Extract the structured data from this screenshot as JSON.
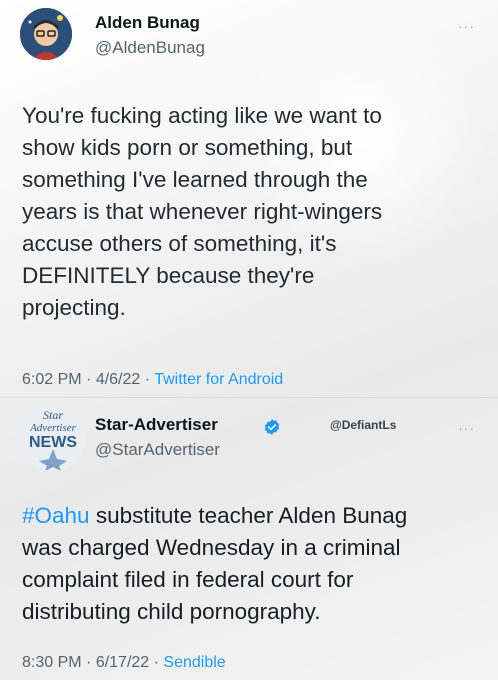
{
  "tweet1": {
    "name": "Alden Bunag",
    "handle": "@AldenBunag",
    "text": "You're fucking acting like we want to\nshow kids porn or something, but\nsomething I've learned through the\nyears is that whenever right-wingers\naccuse others of something, it's\nDEFINITELY because they're\nprojecting.",
    "time": "6:02 PM",
    "date": "4/6/22",
    "source": "Twitter for Android"
  },
  "tweet2": {
    "name": "Star-Advertiser",
    "handle": "@StarAdvertiser",
    "watermark": "@DefiantLs",
    "avatar_text": {
      "line1": "Star",
      "line2": "Advertiser",
      "line3": "NEWS"
    },
    "hashtag": "#Oahu",
    "text": " substitute teacher Alden Bunag\nwas charged Wednesday in a criminal\ncomplaint filed in federal court for\ndistributing child pornography.",
    "time": "8:30 PM",
    "date": "6/17/22",
    "source": "Sendible"
  },
  "more_label": "···",
  "separator": " · ",
  "colors": {
    "link": "#1d9bf0",
    "verified": "#1d9bf0"
  }
}
